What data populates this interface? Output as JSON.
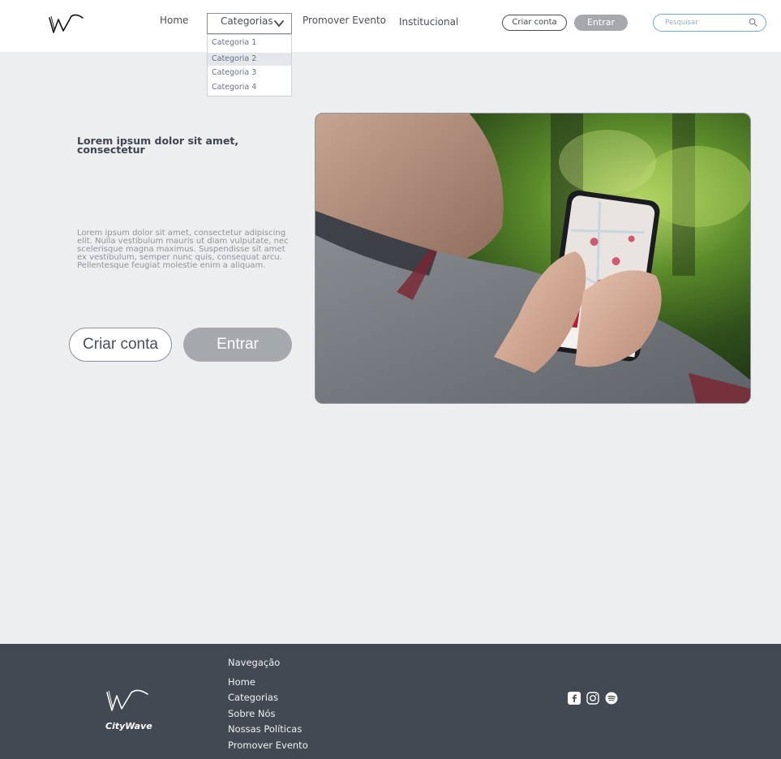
{
  "header": {
    "brand_logo": "citywave-logo",
    "nav": {
      "home": "Home",
      "categorias": "Categorias",
      "promover": "Promover Evento",
      "institucional": "Institucional"
    },
    "dropdown": {
      "items": [
        "Categoria 1",
        "Categoria 2",
        "Categoria 3",
        "Categoria 4"
      ],
      "selected_index": 1
    },
    "criar_conta": "Criar conta",
    "entrar": "Entrar",
    "search": {
      "placeholder": "Pesquisar",
      "icon": "search-icon"
    }
  },
  "hero": {
    "title": "Lorem ipsum dolor sit amet, consectetur",
    "text": "Lorem ipsum dolor sit amet, consectetur adipiscing elit. Nulla vestibulum mauris ut diam vulputate, nec scelerisque magna maximus. Suspendisse sit amet ex vestibulum, semper nunc quis, consequat arcu. Pellentesque feugiat molestie enim a aliquam.",
    "criar_conta": "Criar conta",
    "entrar": "Entrar",
    "image": "person-holding-phone-with-map-photo"
  },
  "footer": {
    "brand": "CityWave",
    "nav_heading": "Navegação",
    "links": [
      "Home",
      "Categorias",
      "Sobre Nós",
      "Nossas Políticas",
      "Promover Evento"
    ],
    "social": [
      "facebook-icon",
      "instagram-icon",
      "spotify-icon"
    ]
  },
  "colors": {
    "accent_search": "#6fa8d6",
    "button_gray": "#a5a8ad",
    "footer_bg": "#424953",
    "page_bg": "#edeef0"
  }
}
